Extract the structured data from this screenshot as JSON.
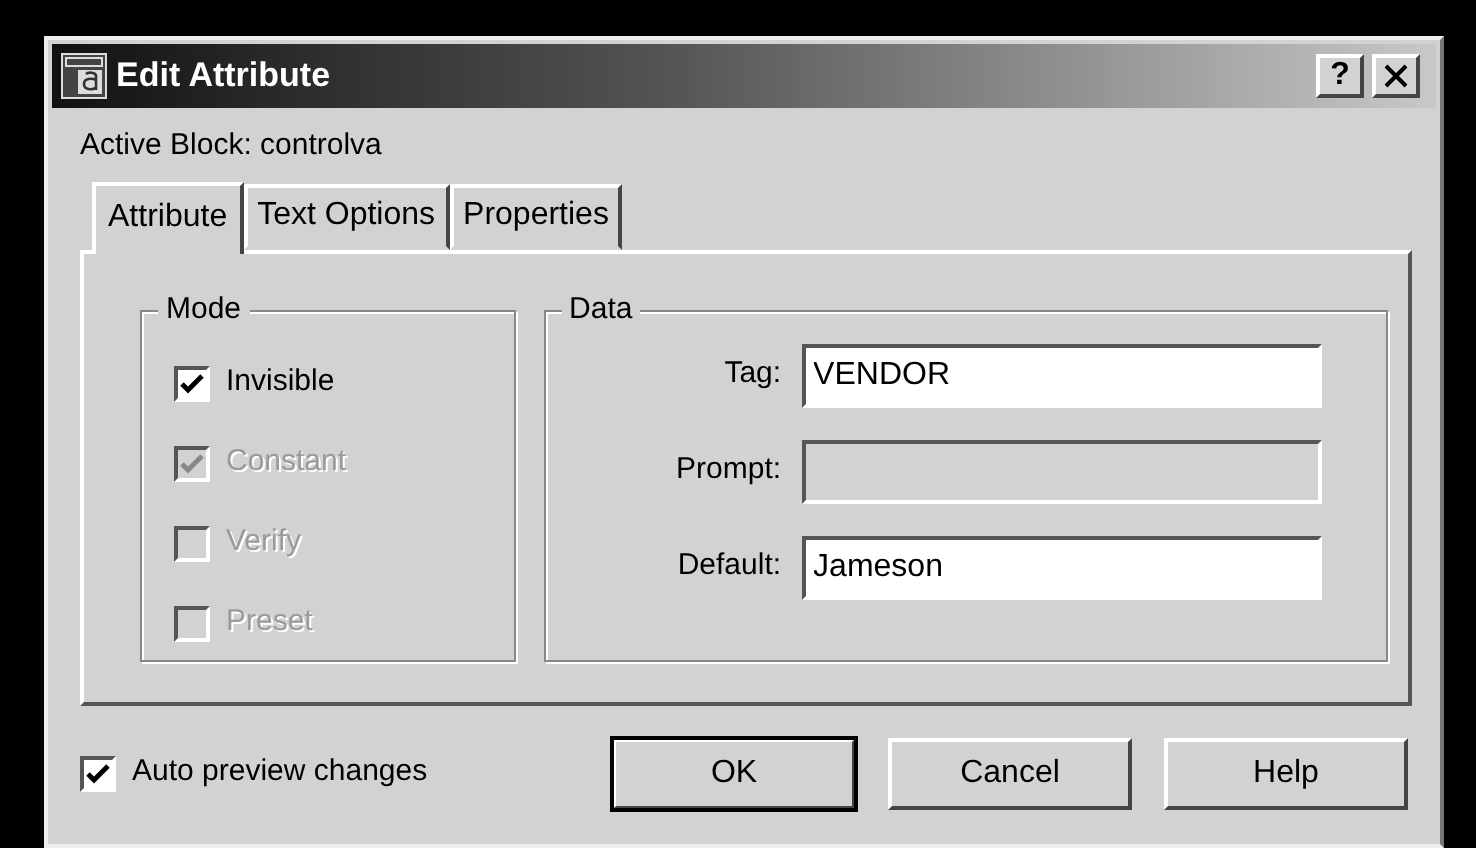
{
  "window": {
    "title": "Edit Attribute",
    "help_button": "?"
  },
  "active_block": "Active Block: controlva",
  "tabs": [
    {
      "label": "Attribute",
      "selected": true
    },
    {
      "label": "Text Options",
      "selected": false
    },
    {
      "label": "Properties",
      "selected": false
    }
  ],
  "mode": {
    "title": "Mode",
    "options": [
      {
        "label": "Invisible",
        "checked": true,
        "disabled": false
      },
      {
        "label": "Constant",
        "checked": true,
        "disabled": true
      },
      {
        "label": "Verify",
        "checked": false,
        "disabled": true
      },
      {
        "label": "Preset",
        "checked": false,
        "disabled": true
      }
    ]
  },
  "data": {
    "title": "Data",
    "fields": [
      {
        "label": "Tag:",
        "value": "VENDOR",
        "disabled": false
      },
      {
        "label": "Prompt:",
        "disabled": true
      },
      {
        "label": "Default:",
        "value": "Jameson",
        "disabled": false
      }
    ]
  },
  "auto_preview": {
    "label": "Auto preview changes",
    "checked": true
  },
  "buttons": [
    {
      "label": "OK",
      "default": true
    },
    {
      "label": "Cancel",
      "default": false
    },
    {
      "label": "Help",
      "default": false
    }
  ]
}
